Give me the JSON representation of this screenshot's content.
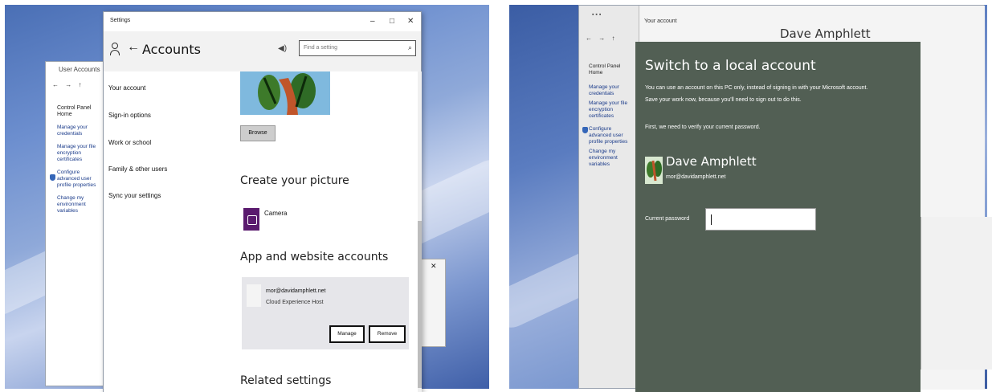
{
  "left": {
    "control_panel": {
      "title": "User Accounts",
      "nav": "← → ↑",
      "home_link": "Control Panel Home",
      "links": [
        "Manage your credentials",
        "Manage your file encryption certificates",
        "Configure advanced user profile properties",
        "Change my environment variables"
      ]
    },
    "settings": {
      "window_title": "Settings",
      "minimize": "–",
      "maximize": "□",
      "close": "✕",
      "header_title": "Accounts",
      "back_glyph": "←",
      "search_placeholder": "Find a setting",
      "nav_items": [
        "Your account",
        "Sign-in options",
        "Work or school",
        "Family & other users",
        "Sync your settings"
      ],
      "browse_label": "Browse",
      "create_picture_heading": "Create your picture",
      "camera_label": "Camera",
      "app_accounts_heading": "App and website accounts",
      "account_email": "mor@davidamphlett.net",
      "account_sub": "Cloud Experience Host",
      "manage_label": "Manage",
      "remove_label": "Remove",
      "related_heading": "Related settings"
    },
    "small_window_close": "✕"
  },
  "right": {
    "control_panel": {
      "nav": "← → ↑",
      "home_link": "Control Panel Home",
      "links": [
        "Manage your credentials",
        "Manage your file encryption certificates",
        "Configure advanced user profile properties",
        "Change my environment variables"
      ]
    },
    "your_account_title": "Your account",
    "your_account_name": "Dave Amphlett",
    "dialog": {
      "title": "Switch to a local account",
      "intro_line1": "You can use an account on this PC only, instead of signing in with your Microsoft account.",
      "intro_line2": "Save your work now, because you'll need to sign out to do this.",
      "verify": "First, we need to verify your current password.",
      "user_name": "Dave Amphlett",
      "user_email": "mor@davidamphlett.net",
      "password_label": "Current password",
      "password_value": ""
    }
  }
}
